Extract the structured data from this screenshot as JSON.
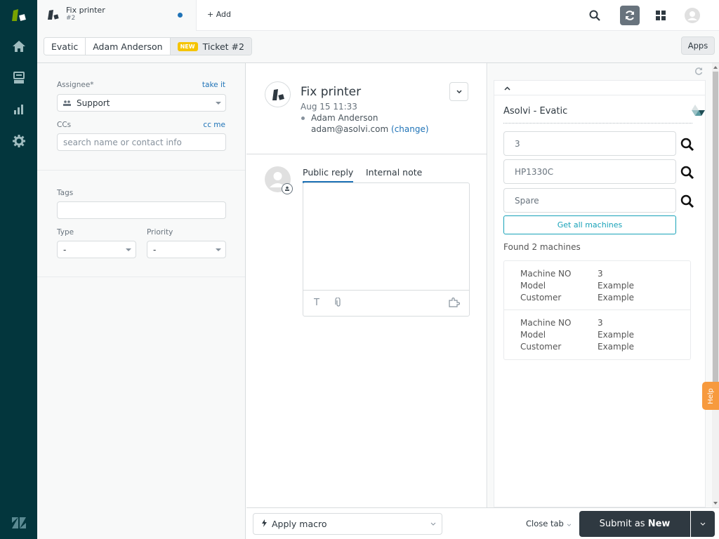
{
  "nav": {
    "items": [
      "home-icon",
      "views-icon",
      "reporting-icon",
      "admin-gear-icon"
    ]
  },
  "topbar": {
    "tab_title": "Fix printer",
    "tab_subtitle": "#2",
    "add_label": "Add"
  },
  "breadcrumb": {
    "items": [
      "Evatic",
      "Adam Anderson",
      "Ticket #2"
    ],
    "badge": "NEW"
  },
  "apps_label": "Apps",
  "left": {
    "assignee_label": "Assignee*",
    "take_it": "take it",
    "assignee_value": "Support",
    "ccs_label": "CCs",
    "cc_me": "cc me",
    "ccs_placeholder": "search name or contact info",
    "tags_label": "Tags",
    "type_label": "Type",
    "type_value": "-",
    "priority_label": "Priority",
    "priority_value": "-"
  },
  "ticket": {
    "title": "Fix printer",
    "date": "Aug 15 11:33",
    "requester": "Adam Anderson",
    "email": "adam@asolvi.com",
    "change": "(change)"
  },
  "reply": {
    "tabs": [
      "Public reply",
      "Internal note"
    ],
    "active_tab": "Public reply"
  },
  "evatic": {
    "title": "Asolvi - Evatic",
    "inputs": [
      "3",
      "HP1330C",
      "Spare"
    ],
    "get_all": "Get all machines",
    "found": "Found 2 machines",
    "machines": [
      {
        "labels": [
          "Machine NO",
          "Model",
          "Customer"
        ],
        "values": [
          "3",
          "Example",
          "Example"
        ]
      },
      {
        "labels": [
          "Machine NO",
          "Model",
          "Customer"
        ],
        "values": [
          "3",
          "Example",
          "Example"
        ]
      }
    ]
  },
  "help_label": "Help",
  "bottom": {
    "macro": "Apply macro",
    "close_tab": "Close tab",
    "submit_prefix": "Submit as ",
    "submit_status": "New"
  },
  "colors": {
    "nav_bg": "#03363d",
    "accent": "#1f73b7",
    "new_badge": "#f5c400",
    "submit_bg": "#2f3941",
    "evatic_teal": "#17a2b8",
    "help": "#f79a3e"
  }
}
